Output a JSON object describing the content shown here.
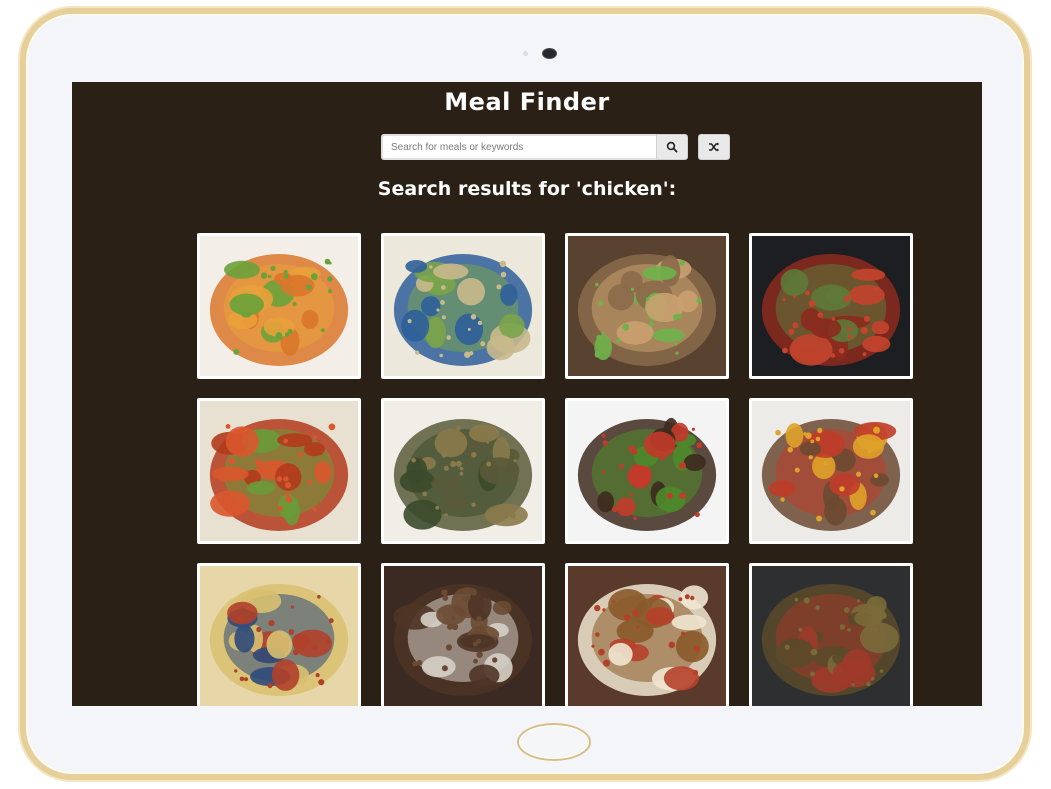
{
  "app": {
    "title": "Meal Finder"
  },
  "search": {
    "placeholder": "Search for meals or keywords",
    "value": ""
  },
  "buttons": {
    "search_icon": "search-icon",
    "random_icon": "shuffle-icon"
  },
  "results": {
    "heading": "Search results for 'chicken':",
    "meals": [
      {
        "palette": [
          "#f3efe8",
          "#d9772a",
          "#6aa23a",
          "#e9a13a"
        ]
      },
      {
        "palette": [
          "#ece8dc",
          "#2f5f9a",
          "#c9b98c",
          "#7aa44a"
        ]
      },
      {
        "palette": [
          "#5a4230",
          "#8a6a4a",
          "#6fb24a",
          "#caa070"
        ]
      },
      {
        "palette": [
          "#1d1e22",
          "#8c2a1e",
          "#c4442c",
          "#5e7a3a"
        ]
      },
      {
        "palette": [
          "#e8e0d0",
          "#b23a1c",
          "#d9572c",
          "#6a9a3a"
        ]
      },
      {
        "palette": [
          "#f1eee8",
          "#5a5a3a",
          "#8a7a4a",
          "#3a4a2a"
        ]
      },
      {
        "palette": [
          "#f4f4f4",
          "#3d2a1e",
          "#c23a2a",
          "#4e8a2a"
        ]
      },
      {
        "palette": [
          "#ecebe7",
          "#6b4a32",
          "#e0a22a",
          "#c03c2a"
        ]
      },
      {
        "palette": [
          "#e6d6a8",
          "#d8c070",
          "#b0402a",
          "#2e4a7a"
        ]
      },
      {
        "palette": [
          "#3a2a22",
          "#4e3426",
          "#6a4a32",
          "#d6d0c6"
        ]
      },
      {
        "palette": [
          "#5a3a2a",
          "#f0e6d0",
          "#b5402a",
          "#8a5a2a"
        ]
      },
      {
        "palette": [
          "#2e2f30",
          "#5a4a2a",
          "#7a6a3a",
          "#a03a2a"
        ]
      }
    ]
  }
}
